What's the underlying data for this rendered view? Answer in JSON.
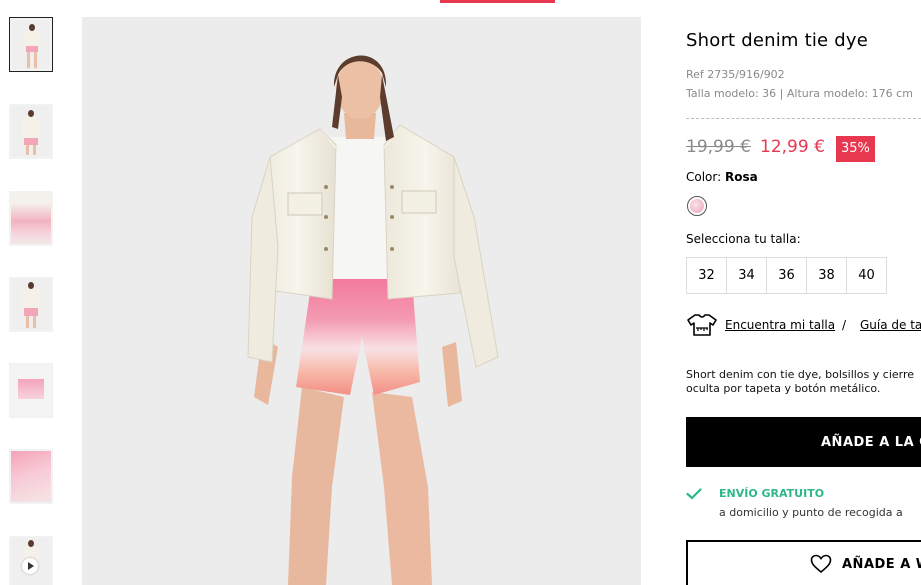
{
  "product": {
    "title": "Short denim tie dye",
    "ref": "Ref 2735/916/902",
    "model_info": "Talla modelo: 36 | Altura modelo: 176 cm",
    "old_price": "19,99 €",
    "new_price": "12,99 €",
    "discount": "35%",
    "color_label": "Color: ",
    "color_value": "Rosa",
    "size_label": "Selecciona tu talla:",
    "sizes": [
      "32",
      "34",
      "36",
      "38",
      "40"
    ],
    "fit_link": "Encuentra mi talla",
    "fit_separator": "/",
    "guide_link": "Guía de tal",
    "description_line1": "Short denim con tie dye, bolsillos y cierre",
    "description_line2": "oculta por tapeta y botón metálico.",
    "add_to_cart": "AÑADE A LA C",
    "shipping_title": "ENVÍO GRATUITO",
    "shipping_sub": "a domicilio y punto de recogida a",
    "wishlist": "AÑADE A WIS"
  },
  "colors": {
    "accent": "#e8384f",
    "shipping": "#2eb888",
    "swatch": "#e9a3b6"
  },
  "icons": {
    "fit": "tshirt-ruler-icon",
    "check": "check-icon",
    "heart": "heart-icon",
    "play": "play-icon"
  }
}
